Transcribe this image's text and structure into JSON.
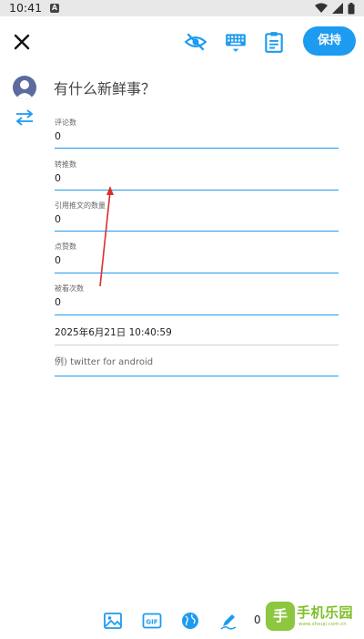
{
  "status_bar": {
    "time": "10:41",
    "notification_glyph": "A"
  },
  "toolbar": {
    "save_label": "保持"
  },
  "compose": {
    "prompt": "有什么新鲜事？"
  },
  "fields": [
    {
      "label": "评论数",
      "value": "0"
    },
    {
      "label": "转推数",
      "value": "0"
    },
    {
      "label": "引用推文的数量",
      "value": "0"
    },
    {
      "label": "点赞数",
      "value": "0"
    },
    {
      "label": "被看次数",
      "value": "0"
    }
  ],
  "datetime": "2025年6月21日 10:40:59",
  "client": {
    "placeholder": "例) twitter for android"
  },
  "bottom_bar": {
    "count": "0",
    "gif_label": "GIF"
  },
  "watermark": {
    "logo_char": "手",
    "title": "手机乐园",
    "url": "www.shouji.com.cn"
  },
  "colors": {
    "accent": "#1d9bf0",
    "arrow": "#d9302c"
  }
}
